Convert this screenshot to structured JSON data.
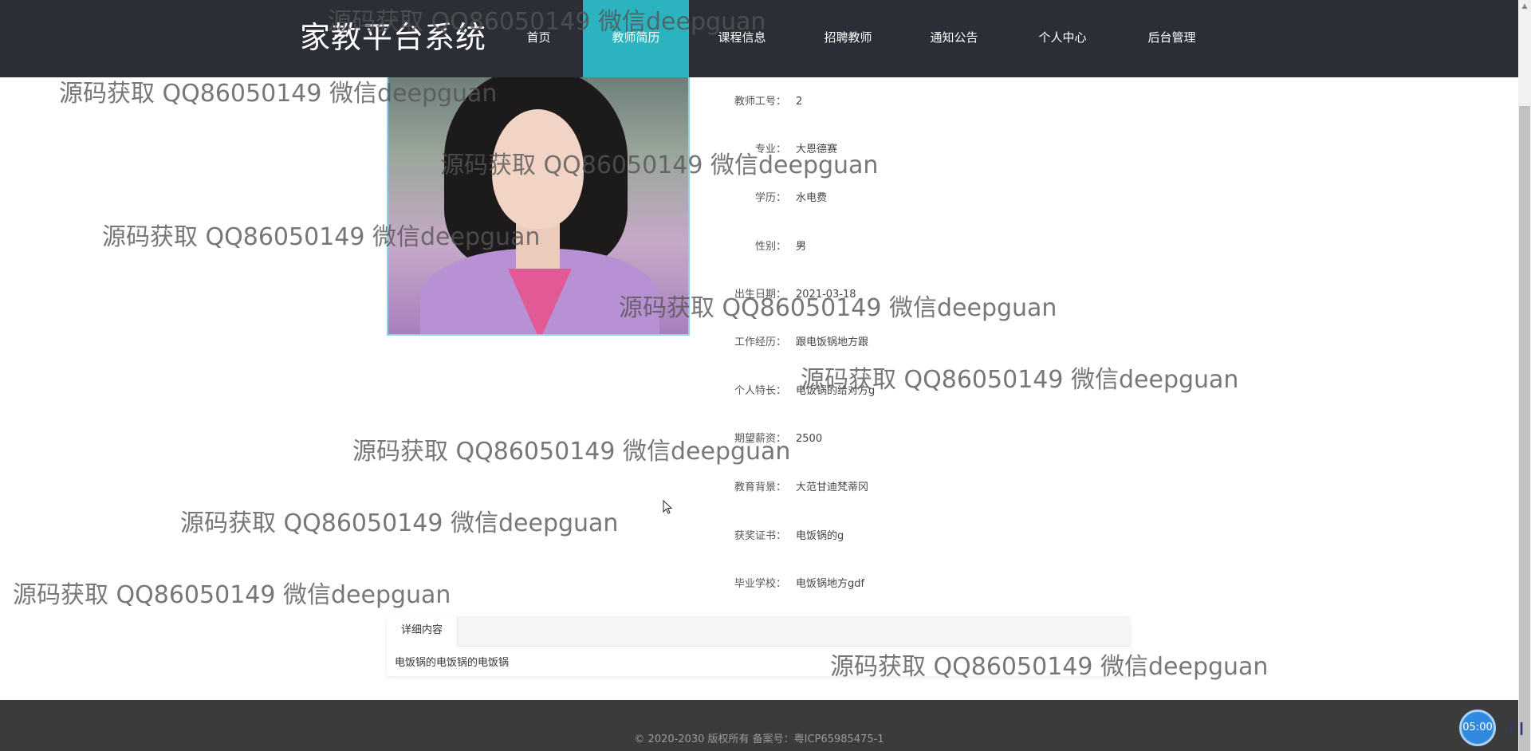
{
  "header": {
    "brand": "家教平台系统",
    "nav": [
      {
        "label": "首页",
        "active": false
      },
      {
        "label": "教师简历",
        "active": true
      },
      {
        "label": "课程信息",
        "active": false
      },
      {
        "label": "招聘教师",
        "active": false
      },
      {
        "label": "通知公告",
        "active": false
      },
      {
        "label": "个人中心",
        "active": false
      },
      {
        "label": "后台管理",
        "active": false
      }
    ]
  },
  "teacher": {
    "fields": [
      {
        "label": "教师工号：",
        "value": "2"
      },
      {
        "label": "专业：",
        "value": "大恩德赛"
      },
      {
        "label": "学历：",
        "value": "水电费"
      },
      {
        "label": "性别：",
        "value": "男"
      },
      {
        "label": "出生日期：",
        "value": "2021-03-18"
      },
      {
        "label": "工作经历：",
        "value": "跟电饭锅地方跟"
      },
      {
        "label": "个人特长：",
        "value": "电饭锅的给对方g"
      },
      {
        "label": "期望薪资：",
        "value": "2500"
      },
      {
        "label": "教育背景：",
        "value": "大范甘迪梵蒂冈"
      },
      {
        "label": "获奖证书：",
        "value": "电饭锅的g"
      },
      {
        "label": "毕业学校：",
        "value": "电饭锅地方gdf"
      }
    ]
  },
  "detail": {
    "tab_label": "详细内容",
    "content": "电饭锅的电饭锅的电饭锅"
  },
  "footer": {
    "copyright": "© 2020-2030 版权所有 备案号：粤ICP65985475-1"
  },
  "watermark": {
    "text": "源码获取 QQ86050149 微信deepguan"
  },
  "widget": {
    "timer": "05:00"
  },
  "colors": {
    "header_bg": "#2b2e36",
    "nav_active": "#2bb3c0",
    "footer_bg": "#3b3b3b",
    "timer_bg": "#2f8ae0"
  }
}
